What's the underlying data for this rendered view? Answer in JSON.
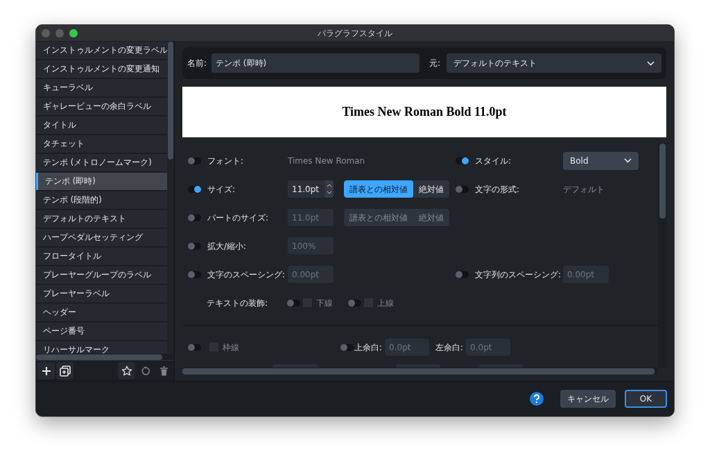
{
  "window": {
    "title": "パラグラフスタイル"
  },
  "sidebar": {
    "items": [
      {
        "label": "インストゥルメントの変更ラベル",
        "selected": false
      },
      {
        "label": "インストゥルメントの変更通知",
        "selected": false
      },
      {
        "label": "キューラベル",
        "selected": false
      },
      {
        "label": "ギャレービューの余白ラベル",
        "selected": false
      },
      {
        "label": "タイトル",
        "selected": false
      },
      {
        "label": "タチェット",
        "selected": false
      },
      {
        "label": "テンポ (メトロノームマーク)",
        "selected": false
      },
      {
        "label": "テンポ (即時)",
        "selected": true
      },
      {
        "label": "テンポ (段階的)",
        "selected": false
      },
      {
        "label": "デフォルトのテキスト",
        "selected": false
      },
      {
        "label": "ハープペダルセッティング",
        "selected": false
      },
      {
        "label": "フロータイトル",
        "selected": false
      },
      {
        "label": "プレーヤーグループのラベル",
        "selected": false
      },
      {
        "label": "プレーヤーラベル",
        "selected": false
      },
      {
        "label": "ヘッダー",
        "selected": false
      },
      {
        "label": "ページ番号",
        "selected": false
      },
      {
        "label": "リハーサルマーク",
        "selected": false
      }
    ],
    "tools": [
      {
        "kind": "add",
        "disabled": false
      },
      {
        "kind": "duplicate",
        "disabled": false
      },
      {
        "kind": "star",
        "disabled": false
      },
      {
        "kind": "revert",
        "disabled": true
      },
      {
        "kind": "delete",
        "disabled": true
      }
    ]
  },
  "name": {
    "label": "名前:",
    "value": "テンポ (即時)"
  },
  "based_on": {
    "label": "元:",
    "value": "デフォルトのテキスト"
  },
  "preview": {
    "text": "Times New Roman Bold 11.0pt"
  },
  "settings": {
    "rows": [
      {
        "left": {
          "kind": "text",
          "on": false,
          "label": "フォント:",
          "value": "Times New Roman"
        },
        "right": {
          "kind": "dropdown",
          "on": true,
          "label": "スタイル:",
          "value": "Bold"
        }
      },
      {
        "left": {
          "kind": "spin",
          "on": true,
          "label": "サイズ:",
          "value": "11.0pt",
          "disabled": false,
          "units": [
            {
              "label": "譜表との相対値",
              "selected": true
            },
            {
              "label": "絶対値",
              "selected": false
            }
          ]
        },
        "right": {
          "kind": "text",
          "on": false,
          "label": "文字の形式:",
          "value": "デフォルト"
        }
      },
      {
        "left": {
          "kind": "field",
          "on": false,
          "label": "パートのサイズ:",
          "value": "11.0pt",
          "disabled": true,
          "units": [
            {
              "label": "譜表との相対値",
              "selected": false
            },
            {
              "label": "絶対値",
              "selected": false
            }
          ]
        }
      },
      {
        "left": {
          "kind": "field",
          "on": false,
          "label": "拡大/縮小:",
          "value": "100%",
          "disabled": true
        }
      },
      {
        "left": {
          "kind": "field",
          "on": false,
          "label": "文字のスペーシング:",
          "value": "0.00pt",
          "disabled": true
        },
        "right": {
          "kind": "field",
          "on": false,
          "label": "文字列のスペーシング:",
          "value": "0.00pt",
          "disabled": true
        }
      }
    ],
    "decoration": {
      "label": "テキストの装飾:",
      "options": [
        {
          "label": "下線",
          "on": false,
          "checked": false
        },
        {
          "label": "上線",
          "on": false,
          "checked": false
        }
      ]
    },
    "border": {
      "label": "枠線",
      "on": false,
      "checked": false
    },
    "margins": [
      {
        "label": "上余白:",
        "value": "0.0pt",
        "on": false
      },
      {
        "label": "左余白:",
        "value": "0.0pt"
      }
    ]
  },
  "footer": {
    "cancel": "キャンセル",
    "ok": "OK"
  }
}
